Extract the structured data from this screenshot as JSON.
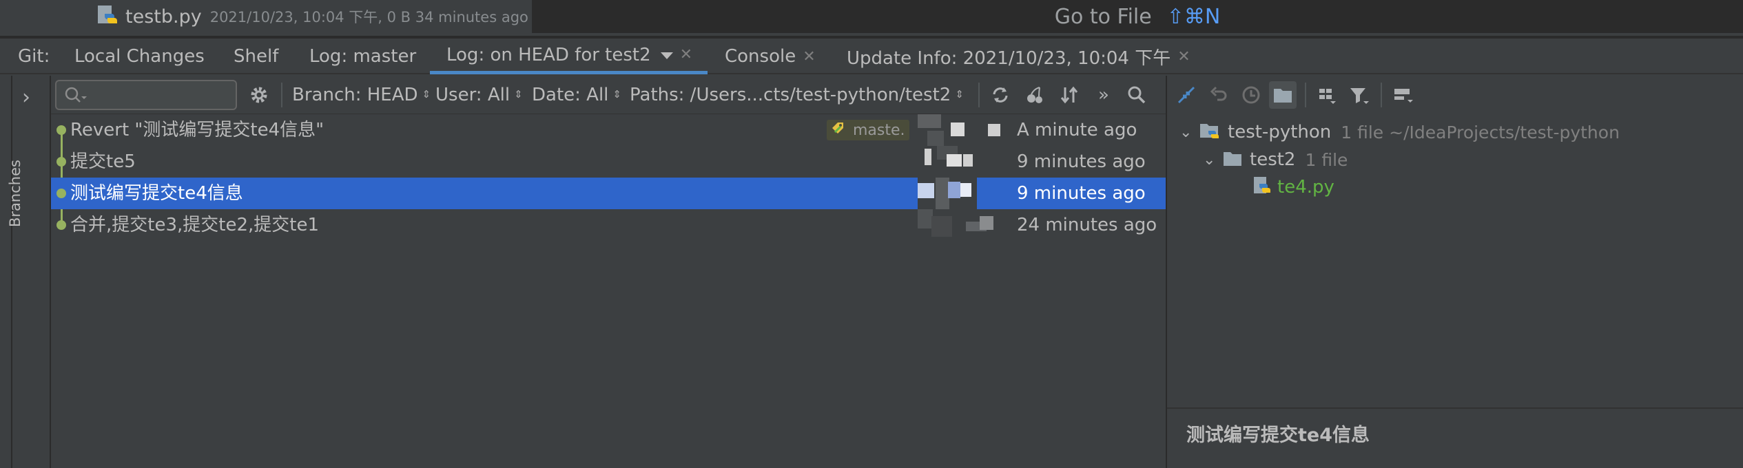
{
  "top": {
    "file_name": "testb.py",
    "file_meta": "2021/10/23, 10:04 下午, 0 B 34 minutes ago",
    "goto_label": "Go to File",
    "goto_shortcut": "⇧⌘N"
  },
  "tabs": {
    "git_label": "Git:",
    "items": [
      {
        "label": "Local Changes"
      },
      {
        "label": "Shelf"
      },
      {
        "label": "Log: master"
      },
      {
        "label": "Log: on HEAD for test2"
      },
      {
        "label": "Console"
      },
      {
        "label": "Update Info: 2021/10/23, 10:04 下午"
      }
    ],
    "active_index": 3
  },
  "sidebar": {
    "branches_label": "Branches"
  },
  "log_toolbar": {
    "search_placeholder": "",
    "branch_filter": "Branch: HEAD",
    "user_filter": "User: All",
    "date_filter": "Date: All",
    "paths_filter": "Paths: /Users...cts/test-python/test2"
  },
  "commits": [
    {
      "message": "Revert \"测试编写提交te4信息\"",
      "date": "A minute ago",
      "tag": "maste."
    },
    {
      "message": "提交te5",
      "date": "9 minutes ago"
    },
    {
      "message": "测试编写提交te4信息",
      "date": "9 minutes ago",
      "selected": true
    },
    {
      "message": "合并,提交te3,提交te2,提交te1",
      "date": "24 minutes ago"
    }
  ],
  "changes_tree": {
    "root": {
      "name": "test-python",
      "meta": "1 file  ~/IdeaProjects/test-python"
    },
    "folder": {
      "name": "test2",
      "meta": "1 file"
    },
    "file": {
      "name": "te4.py"
    }
  },
  "detail": {
    "commit_message": "测试编写提交te4信息"
  },
  "colors": {
    "background": "#3c3f41",
    "selection": "#2f65ca",
    "graph": "#97b260",
    "tab_underline": "#4a88c7",
    "added_file": "#62b543"
  }
}
